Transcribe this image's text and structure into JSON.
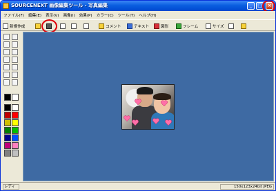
{
  "window": {
    "title": "SOURCENEXT 画像編集ツール - 写真編集",
    "min_label": "_",
    "max_label": "□",
    "close_label": "×"
  },
  "menu": [
    "ファイル(F)",
    "編集(E)",
    "表示(V)",
    "画像(I)",
    "効果(P)",
    "カラー(C)",
    "ツール(T)",
    "ヘルプ(H)"
  ],
  "toolbar": {
    "new_label": "新規作成",
    "comment_label": "コメント",
    "text_label": "テキスト",
    "shape_label": "図形",
    "frame_label": "フレーム",
    "size_label": "サイズ"
  },
  "status": {
    "left": "レディ",
    "right": "150x123x24bit JPEG"
  },
  "colors": {
    "workspace": "#3e6aa3",
    "titlebar": "#0a5ee0",
    "highlight_ring": "#e0000a",
    "palette": [
      "#000000",
      "#ffffff",
      "#7f0000",
      "#ff0000",
      "#7f7f00",
      "#ffff00",
      "#007f00",
      "#00ff00",
      "#00007f",
      "#0000ff",
      "#7f007f",
      "#ff00ff",
      "#007f7f",
      "#00ffff",
      "#7f7f7f",
      "#c0c0c0"
    ]
  }
}
